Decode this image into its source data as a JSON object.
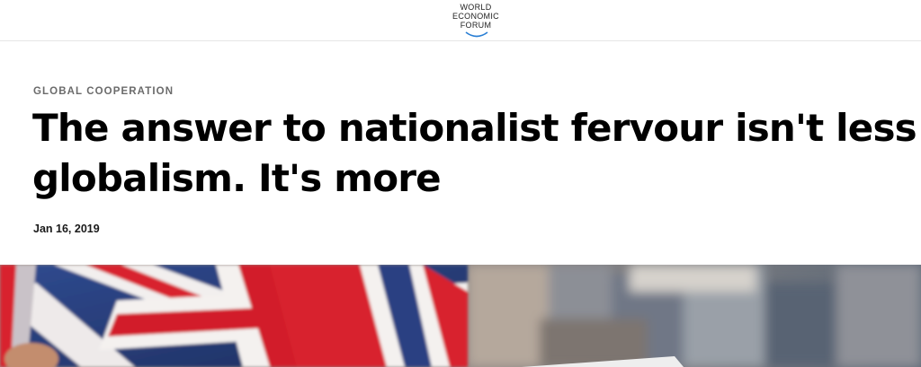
{
  "header": {
    "logo_lines": [
      "WORLD",
      "ECONOMIC",
      "FORUM"
    ],
    "logo_accent_color": "#2a7fd4"
  },
  "article": {
    "category": "GLOBAL COOPERATION",
    "headline_line1": "The answer to nationalist fervour isn't less",
    "headline_line2": "globalism. It's more",
    "date": "Jan 16, 2019"
  },
  "hero_image": {
    "subject": "flag-photo",
    "colors": {
      "red": "#d8242d",
      "blue": "#263a78",
      "white": "#f4f1ef",
      "background": "#8a8680"
    }
  }
}
